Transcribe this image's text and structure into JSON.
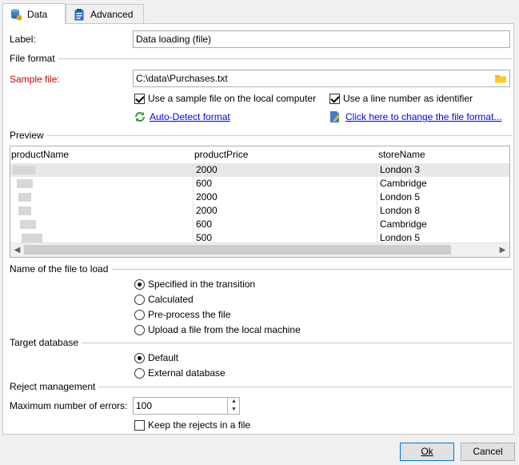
{
  "tabs": [
    {
      "label": "Data",
      "icon": "database-icon",
      "active": true
    },
    {
      "label": "Advanced",
      "icon": "clipboard-icon",
      "active": false
    }
  ],
  "label_field": {
    "label": "Label:",
    "value": "Data loading (file)"
  },
  "file_format": {
    "section_title": "File format",
    "sample_file_label": "Sample file:",
    "sample_file_value": "C:\\data\\Purchases.txt",
    "use_sample_local": {
      "label": "Use a sample file on the local computer",
      "checked": true
    },
    "use_line_number": {
      "label": "Use a line number as identifier",
      "checked": true
    },
    "auto_detect_link": "Auto-Detect format",
    "change_format_link": "Click here to change the file format..."
  },
  "preview": {
    "section_title": "Preview",
    "columns": [
      "productName",
      "productPrice",
      "storeName"
    ],
    "rows": [
      {
        "productPrice": "2000",
        "storeName": "London 3"
      },
      {
        "productPrice": "600",
        "storeName": "Cambridge"
      },
      {
        "productPrice": "2000",
        "storeName": "London 5"
      },
      {
        "productPrice": "2000",
        "storeName": "London 8"
      },
      {
        "productPrice": "600",
        "storeName": "Cambridge"
      },
      {
        "productPrice": "500",
        "storeName": "London 5"
      }
    ]
  },
  "file_to_load": {
    "section_title": "Name of the file to load",
    "options": [
      {
        "label": "Specified in the transition",
        "checked": true
      },
      {
        "label": "Calculated",
        "checked": false
      },
      {
        "label": "Pre-process the file",
        "checked": false
      },
      {
        "label": "Upload a file from the local machine",
        "checked": false
      }
    ]
  },
  "target_db": {
    "section_title": "Target database",
    "options": [
      {
        "label": "Default",
        "checked": true
      },
      {
        "label": "External database",
        "checked": false
      }
    ]
  },
  "reject": {
    "section_title": "Reject management",
    "max_errors_label": "Maximum number of errors:",
    "max_errors_value": "100",
    "keep_rejects": {
      "label": "Keep the rejects in a file",
      "checked": false
    }
  },
  "buttons": {
    "ok": "Ok",
    "cancel": "Cancel"
  },
  "colors": {
    "required_label": "#d00000",
    "link": "#0000ee",
    "folder": "#f2b100"
  }
}
